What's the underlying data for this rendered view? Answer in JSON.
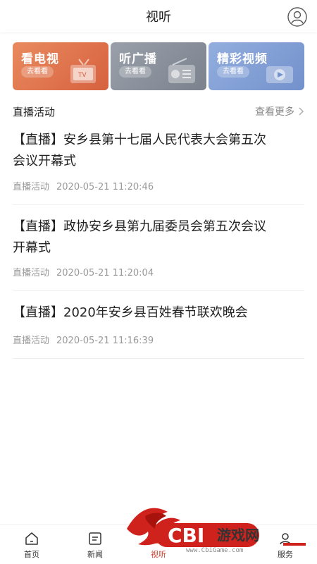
{
  "header": {
    "title": "视听"
  },
  "cards": [
    {
      "title": "看电视",
      "button": "去看看",
      "color": "#e0744c"
    },
    {
      "title": "听广播",
      "button": "去看看",
      "color": "#8a909a"
    },
    {
      "title": "精彩视频",
      "button": "去看看",
      "color": "#839fd6"
    }
  ],
  "section": {
    "title": "直播活动",
    "more": "查看更多"
  },
  "news": [
    {
      "title_line1": "【直播】安乡县第十七届人民代表大会第五次",
      "title_line2": "会议开幕式",
      "category": "直播活动",
      "time": "2020-05-21 11:20:46"
    },
    {
      "title_line1": "【直播】政协安乡县第九届委员会第五次会议",
      "title_line2": "开幕式",
      "category": "直播活动",
      "time": "2020-05-21 11:20:04"
    },
    {
      "title_line1": "【直播】2020年安乡县百姓春节联欢晚会",
      "title_line2": "",
      "category": "直播活动",
      "time": "2020-05-21 11:16:39"
    }
  ],
  "bottom_nav": [
    {
      "label": "首页",
      "icon": "home-icon"
    },
    {
      "label": "新闻",
      "icon": "news-icon"
    },
    {
      "label": "视听",
      "icon": "media-icon"
    },
    {
      "label": "",
      "icon": "service-icon"
    },
    {
      "label": "服务",
      "icon": "user-icon"
    }
  ],
  "watermark": {
    "brand": "CBI",
    "url": "www.CbiGame.com"
  },
  "colors": {
    "accent": "#cc3c2e",
    "tv": "#e0744c",
    "radio": "#8a909a",
    "video": "#839fd6"
  }
}
